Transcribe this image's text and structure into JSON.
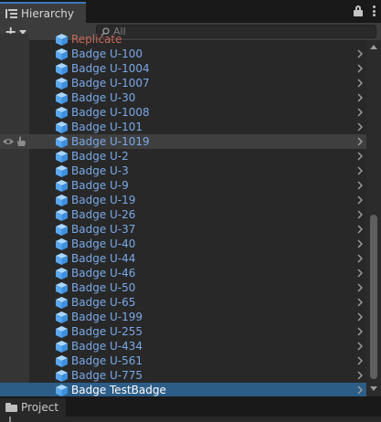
{
  "window": {
    "tab_label": "Hierarchy",
    "tools": [
      "lock-icon",
      "more-icon"
    ]
  },
  "toolbar": {
    "add_icon": "plus-icon",
    "search_placeholder": "All",
    "search_value": ""
  },
  "hierarchy": {
    "partial_item": "Replicate",
    "items": [
      {
        "label": "Badge U-100"
      },
      {
        "label": "Badge U-1004"
      },
      {
        "label": "Badge U-1007"
      },
      {
        "label": "Badge U-30"
      },
      {
        "label": "Badge U-1008"
      },
      {
        "label": "Badge U-101"
      },
      {
        "label": "Badge U-1019"
      },
      {
        "label": "Badge U-2"
      },
      {
        "label": "Badge U-3"
      },
      {
        "label": "Badge U-9"
      },
      {
        "label": "Badge U-19"
      },
      {
        "label": "Badge U-26"
      },
      {
        "label": "Badge U-37"
      },
      {
        "label": "Badge U-40"
      },
      {
        "label": "Badge U-44"
      },
      {
        "label": "Badge U-46"
      },
      {
        "label": "Badge U-50"
      },
      {
        "label": "Badge U-65"
      },
      {
        "label": "Badge U-199"
      },
      {
        "label": "Badge U-255"
      },
      {
        "label": "Badge U-434"
      },
      {
        "label": "Badge U-561"
      },
      {
        "label": "Badge U-775"
      },
      {
        "label": "Badge TestBadge"
      }
    ],
    "hovered_item": "Badge U-1019",
    "selected_item": "Badge TestBadge",
    "colors": {
      "prefab_text": "#7aa8e6",
      "selected_row": "#2c5d87",
      "selected_text": "#ffffff",
      "missing_text": "#c86a5a"
    }
  },
  "bottom_panel": {
    "tab_label": "Project"
  }
}
